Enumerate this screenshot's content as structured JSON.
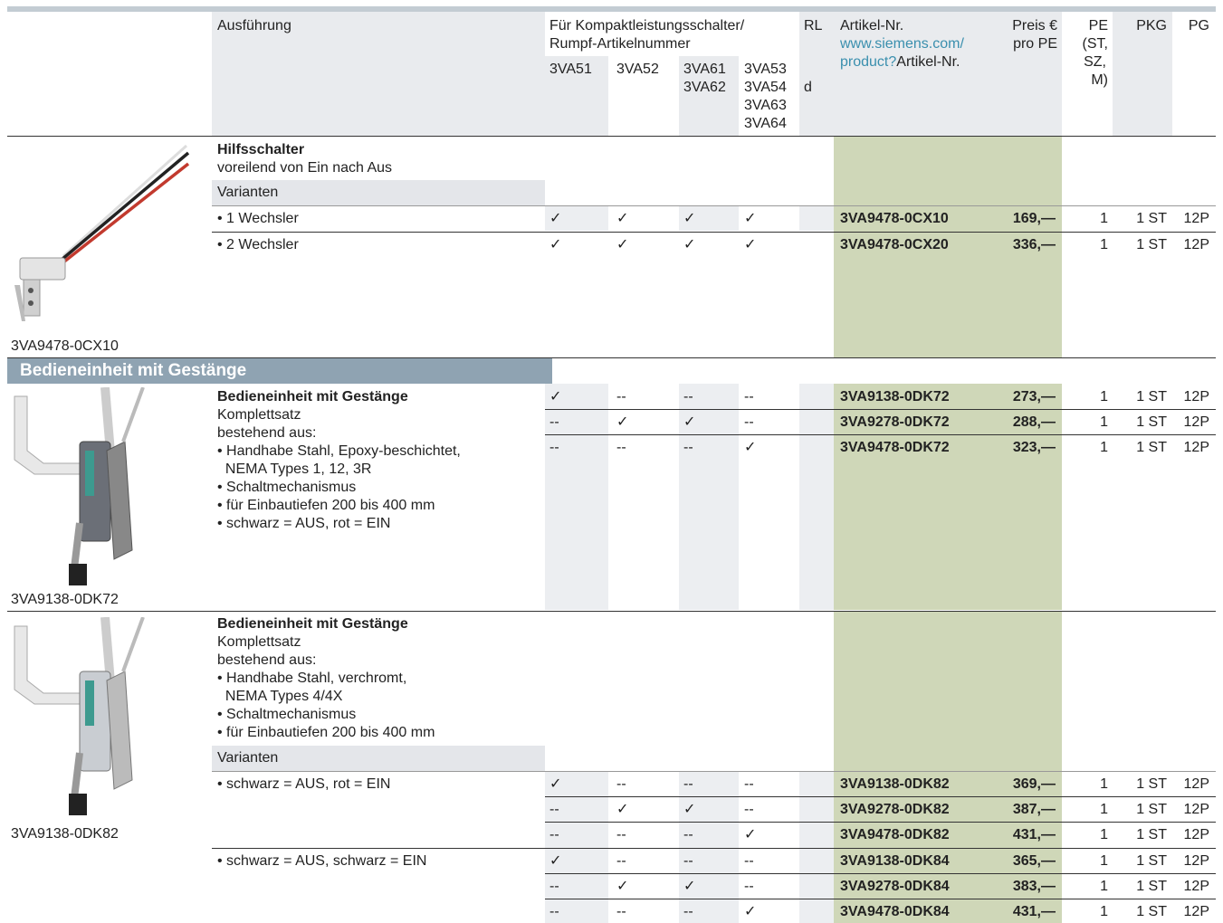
{
  "colors": {
    "top_bar": "#c3ccd3",
    "header_bg": "#e9ebee",
    "article_col_bg": "#cfd7b8",
    "section_bar": "#8fa3b2",
    "variant_bar": "#e4e6ea",
    "link": "#3a8fae"
  },
  "header": {
    "ausfuehrung": "Ausführung",
    "kompakt_line1": "Für Kompaktleistungsschalter/",
    "kompakt_line2": "Rumpf-Artikelnummer",
    "col_3va51": "3VA51",
    "col_3va52": "3VA52",
    "col_3va61": "3VA61",
    "col_3va62": "3VA62",
    "col_3va53": "3VA53",
    "col_3va54": "3VA54",
    "col_3va63": "3VA63",
    "col_3va64": "3VA64",
    "rl": "RL",
    "rl_value": "d",
    "artikel": "Artikel-Nr.",
    "link_line1": "www.siemens.com/",
    "link_line2": "product?",
    "link_suffix": "Artikel-Nr.",
    "preis_line1": "Preis €",
    "preis_line2": "pro PE",
    "pe_line1": "PE",
    "pe_line2": "(ST,",
    "pe_line3": "SZ,",
    "pe_line4": "M)",
    "pkg": "PKG",
    "pg": "PG"
  },
  "section1": {
    "title": "Hilfsschalter",
    "subtitle": "voreilend von Ein nach Aus",
    "varianten": "Varianten",
    "image_caption": "3VA9478-0CX10",
    "rows": [
      {
        "label": "• 1 Wechsler",
        "c1": "✓",
        "c2": "✓",
        "c3": "✓",
        "c4": "✓",
        "article": "3VA9478-0CX10",
        "price": "169,—",
        "pe": "1",
        "pkg": "1 ST",
        "pg": "12P"
      },
      {
        "label": "• 2 Wechsler",
        "c1": "✓",
        "c2": "✓",
        "c3": "✓",
        "c4": "✓",
        "article": "3VA9478-0CX20",
        "price": "336,—",
        "pe": "1",
        "pkg": "1 ST",
        "pg": "12P"
      }
    ]
  },
  "section_bar_title": "Bedieneinheit mit Gestänge",
  "section2": {
    "title": "Bedieneinheit mit Gestänge",
    "lines": [
      "Komplettsatz",
      "bestehend aus:",
      "• Handhabe Stahl, Epoxy-beschichtet,",
      "  NEMA Types 1, 12, 3R",
      "• Schaltmechanismus",
      "• für Einbautiefen 200 bis 400 mm",
      "• schwarz = AUS, rot = EIN"
    ],
    "image_caption": "3VA9138-0DK72",
    "rows": [
      {
        "c1": "✓",
        "c2": "--",
        "c3": "--",
        "c4": "--",
        "article": "3VA9138-0DK72",
        "price": "273,—",
        "pe": "1",
        "pkg": "1 ST",
        "pg": "12P"
      },
      {
        "c1": "--",
        "c2": "✓",
        "c3": "✓",
        "c4": "--",
        "article": "3VA9278-0DK72",
        "price": "288,—",
        "pe": "1",
        "pkg": "1 ST",
        "pg": "12P"
      },
      {
        "c1": "--",
        "c2": "--",
        "c3": "--",
        "c4": "✓",
        "article": "3VA9478-0DK72",
        "price": "323,—",
        "pe": "1",
        "pkg": "1 ST",
        "pg": "12P"
      }
    ]
  },
  "section3": {
    "title": "Bedieneinheit mit Gestänge",
    "lines": [
      "Komplettsatz",
      "bestehend aus:",
      "• Handhabe Stahl, verchromt,",
      "  NEMA Types 4/4X",
      "• Schaltmechanismus",
      "• für Einbautiefen 200 bis 400 mm"
    ],
    "varianten": "Varianten",
    "image_caption": "3VA9138-0DK82",
    "variant_a": "• schwarz = AUS, rot = EIN",
    "variant_b": "• schwarz = AUS, schwarz = EIN",
    "rows": [
      {
        "c1": "✓",
        "c2": "--",
        "c3": "--",
        "c4": "--",
        "article": "3VA9138-0DK82",
        "price": "369,—",
        "pe": "1",
        "pkg": "1 ST",
        "pg": "12P"
      },
      {
        "c1": "--",
        "c2": "✓",
        "c3": "✓",
        "c4": "--",
        "article": "3VA9278-0DK82",
        "price": "387,—",
        "pe": "1",
        "pkg": "1 ST",
        "pg": "12P"
      },
      {
        "c1": "--",
        "c2": "--",
        "c3": "--",
        "c4": "✓",
        "article": "3VA9478-0DK82",
        "price": "431,—",
        "pe": "1",
        "pkg": "1 ST",
        "pg": "12P"
      },
      {
        "c1": "✓",
        "c2": "--",
        "c3": "--",
        "c4": "--",
        "article": "3VA9138-0DK84",
        "price": "365,—",
        "pe": "1",
        "pkg": "1 ST",
        "pg": "12P"
      },
      {
        "c1": "--",
        "c2": "✓",
        "c3": "✓",
        "c4": "--",
        "article": "3VA9278-0DK84",
        "price": "383,—",
        "pe": "1",
        "pkg": "1 ST",
        "pg": "12P"
      },
      {
        "c1": "--",
        "c2": "--",
        "c3": "--",
        "c4": "✓",
        "article": "3VA9478-0DK84",
        "price": "431,—",
        "pe": "1",
        "pkg": "1 ST",
        "pg": "12P"
      }
    ]
  }
}
